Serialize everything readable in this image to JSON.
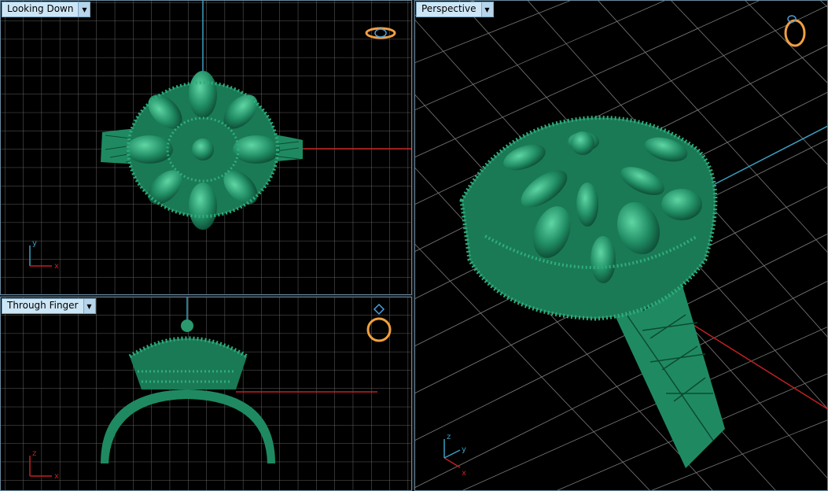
{
  "viewports": {
    "top": {
      "label": "Looking Down",
      "axis_labels": {
        "vertical": "y",
        "horizontal": "x"
      }
    },
    "front": {
      "label": "Through Finger",
      "axis_labels": {
        "vertical": "z",
        "horizontal": "x"
      }
    },
    "perspective": {
      "label": "Perspective",
      "axis_labels": {
        "vertical": "z",
        "horizontal": "x",
        "depth": "y"
      }
    }
  },
  "colors": {
    "background": "#000000",
    "grid": "#7a7a7a",
    "model": "#1f8a62",
    "axis_x": "#c02020",
    "axis_y": "#3aa0c0",
    "gizmo": "#f0a040",
    "label_bg": "#cde6f6"
  },
  "icons": {
    "dropdown": "chevron-down-icon",
    "view_gizmo": "ring-orientation-icon"
  }
}
